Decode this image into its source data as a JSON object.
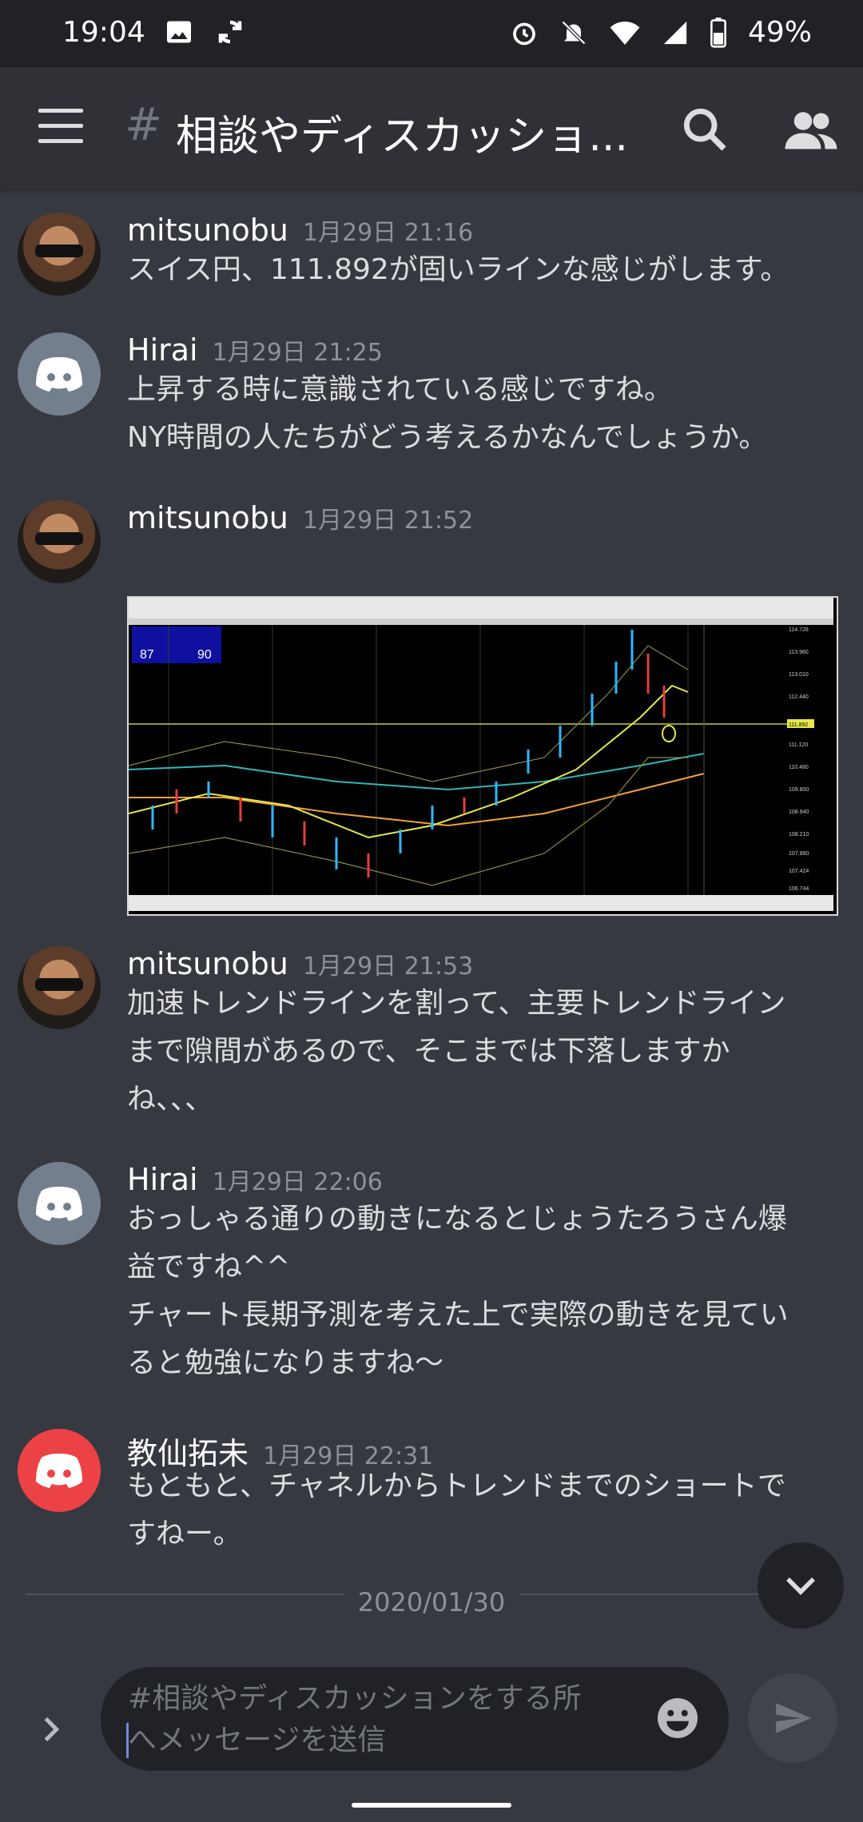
{
  "status_bar": {
    "time": "19:04",
    "battery": "49%"
  },
  "header": {
    "channel_title": "相談やディスカッショ..."
  },
  "messages": [
    {
      "author": "mitsunobu",
      "time": "1月29日 21:16",
      "lines": [
        "スイス円、111.892が固いラインな感じがします。"
      ]
    },
    {
      "author": "Hirai",
      "time": "1月29日 21:25",
      "lines": [
        "上昇する時に意識されている感じですね。",
        "NY時間の人たちがどう考えるかなんでしょうか。"
      ]
    },
    {
      "author": "mitsunobu",
      "time": "1月29日 21:52",
      "lines": []
    },
    {
      "author": "mitsunobu",
      "time": "1月29日 21:53",
      "lines": [
        "加速トレンドラインを割って、主要トレンドライン",
        "まで隙間があるので、そこまでは下落しますか",
        "ね、、、"
      ]
    },
    {
      "author": "Hirai",
      "time": "1月29日 22:06",
      "lines": [
        "おっしゃる通りの動きになるとじょうたろうさん爆",
        "益ですね^^",
        "チャート長期予測を考えた上で実際の動きを見てい",
        "ると勉強になりますね〜"
      ]
    },
    {
      "author": "教仙拓未",
      "time": "1月29日 22:31",
      "lines": [
        "もともと、チャネルからトレンドまでのショートで",
        "すねー。"
      ]
    }
  ],
  "chart_image": {
    "left_labels": [
      "87",
      "90"
    ],
    "price_labels": [
      "114.728",
      "113.960",
      "113.010",
      "112.440",
      "111.892",
      "111.120",
      "110.480",
      "109.800",
      "108.940",
      "108.210",
      "107.860",
      "107.424",
      "106.744"
    ]
  },
  "date_divider": "2020/01/30",
  "composer": {
    "placeholder_line1": "#相談やディスカッションをする所",
    "placeholder_line2": "へメッセージを送信"
  },
  "icons": {
    "menu": "menu-icon",
    "search": "search-icon",
    "members": "members-icon",
    "emoji": "emoji-icon",
    "send": "send-icon",
    "expand": "chevron-right-icon",
    "jump": "chevron-down-icon"
  }
}
